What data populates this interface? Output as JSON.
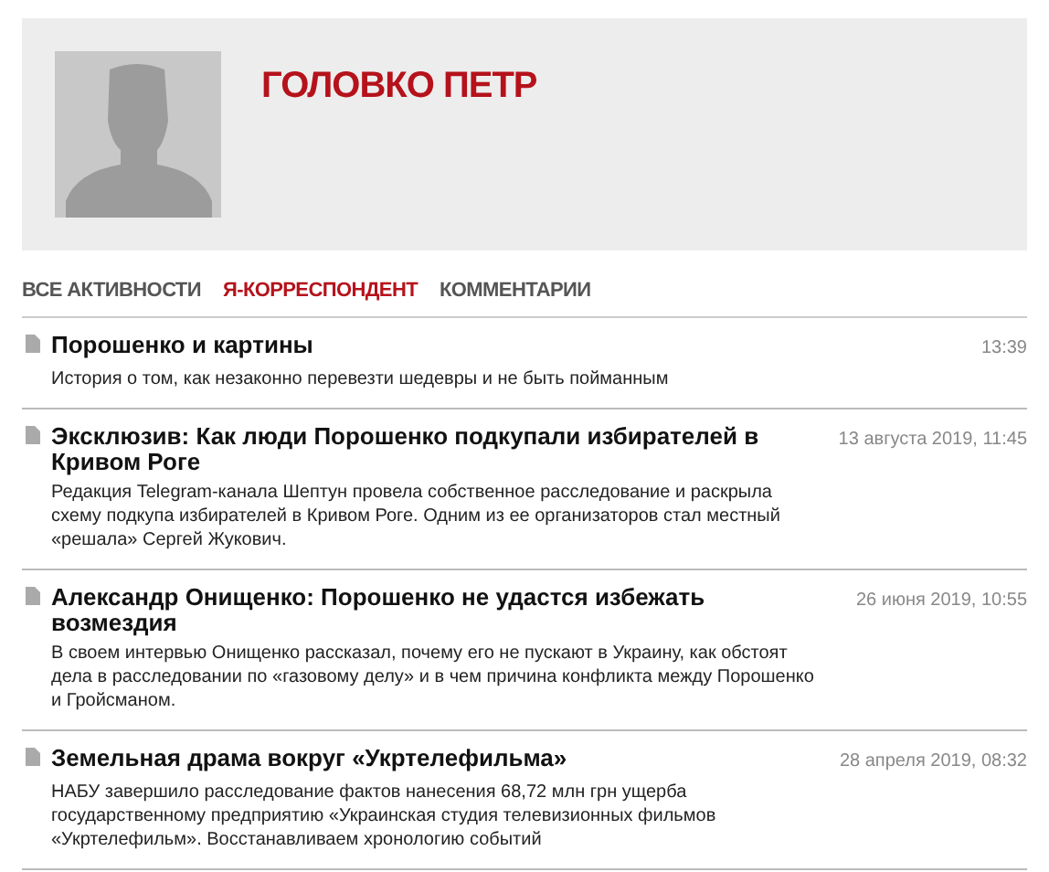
{
  "profile": {
    "name": "ГОЛОВКО ПЕТР"
  },
  "tabs": [
    {
      "label": "ВСЕ АКТИВНОСТИ",
      "selected": false
    },
    {
      "label": "Я-КОРРЕСПОНДЕНТ",
      "selected": true
    },
    {
      "label": "КОММЕНТАРИИ",
      "selected": false
    }
  ],
  "articles": [
    {
      "title": "Порошенко и картины",
      "date": "13:39",
      "summary": "История о том, как незаконно перевезти шедевры и не быть пойманным"
    },
    {
      "title": "Эксклюзив: Как люди Порошенко подкупали избирателей в Кривом Роге",
      "date": "13 августа 2019, 11:45",
      "summary": "Редакция Telegram-канала Шептун провела собственное расследование и раскрыла схему подкупа избирателей в Кривом Роге. Одним из ее организаторов стал местный «решала» Сергей Жукович."
    },
    {
      "title": "Александр Онищенко: Порошенко не удастся избежать возмездия",
      "date": "26 июня 2019, 10:55",
      "summary": "В своем интервью Онищенко рассказал, почему его не пускают в Украину, как обстоят дела в расследовании по «газовому делу» и в чем причина конфликта между Порошенко и Гройсманом."
    },
    {
      "title": "Земельная драма вокруг «Укртелефильма»",
      "date": "28 апреля 2019, 08:32",
      "summary": "НАБУ завершило расследование фактов нанесения 68,72 млн грн ущерба государственному предприятию «Украинская студия телевизионных фильмов «Укртелефильм». Восстанавливаем хронологию событий"
    }
  ]
}
